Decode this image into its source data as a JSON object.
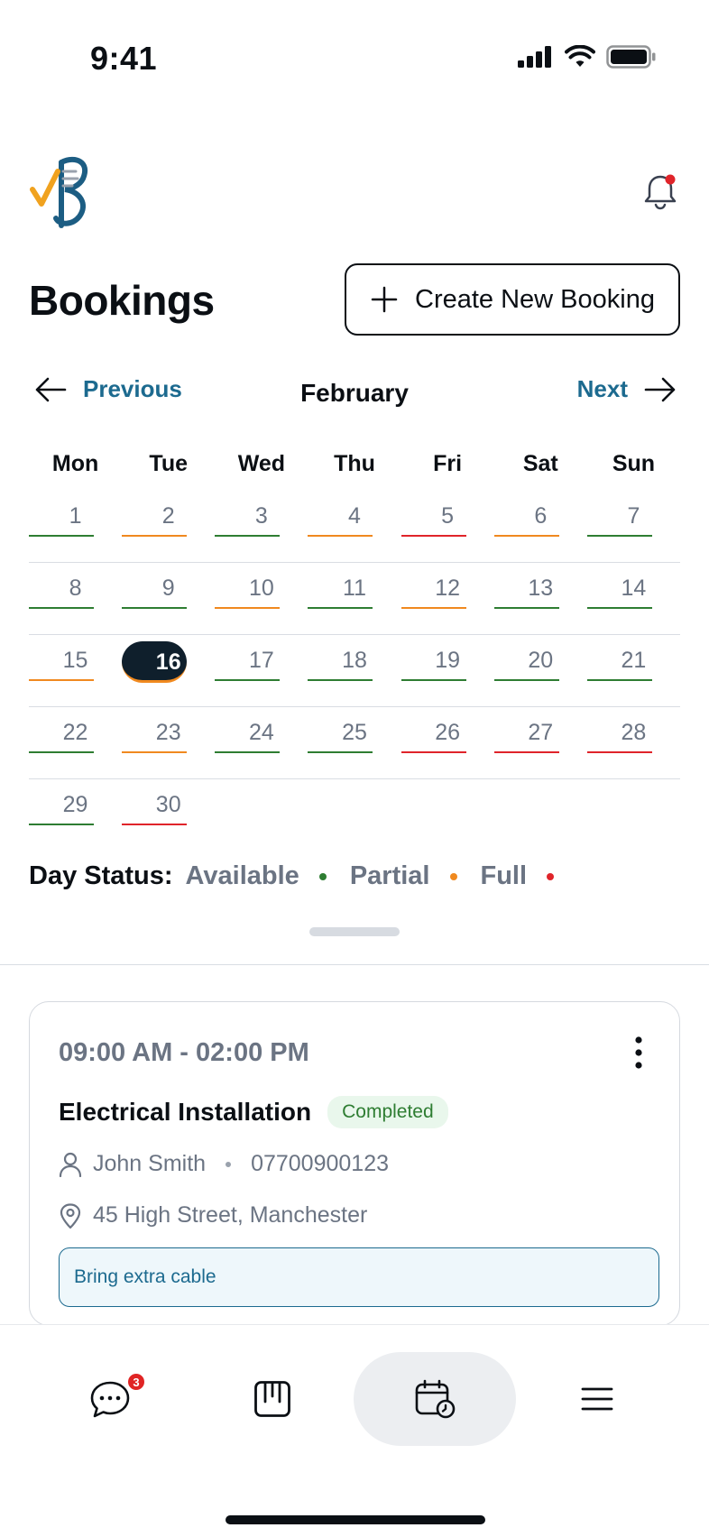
{
  "status_bar": {
    "time": "9:41"
  },
  "header": {
    "page_title": "Bookings",
    "create_button_label": "Create New Booking"
  },
  "month_nav": {
    "prev_label": "Previous",
    "month": "February",
    "next_label": "Next"
  },
  "weekdays": [
    "Mon",
    "Tue",
    "Wed",
    "Thu",
    "Fri",
    "Sat",
    "Sun"
  ],
  "calendar": {
    "selected_day": "16",
    "rows": [
      [
        {
          "d": "1",
          "s": "available"
        },
        {
          "d": "2",
          "s": "partial"
        },
        {
          "d": "3",
          "s": "available"
        },
        {
          "d": "4",
          "s": "partial"
        },
        {
          "d": "5",
          "s": "full"
        },
        {
          "d": "6",
          "s": "partial"
        },
        {
          "d": "7",
          "s": "available"
        }
      ],
      [
        {
          "d": "8",
          "s": "available"
        },
        {
          "d": "9",
          "s": "available"
        },
        {
          "d": "10",
          "s": "partial"
        },
        {
          "d": "11",
          "s": "available"
        },
        {
          "d": "12",
          "s": "partial"
        },
        {
          "d": "13",
          "s": "available"
        },
        {
          "d": "14",
          "s": "available"
        }
      ],
      [
        {
          "d": "15",
          "s": "partial"
        },
        {
          "d": "16",
          "s": "partial"
        },
        {
          "d": "17",
          "s": "available"
        },
        {
          "d": "18",
          "s": "available"
        },
        {
          "d": "19",
          "s": "available"
        },
        {
          "d": "20",
          "s": "available"
        },
        {
          "d": "21",
          "s": "available"
        }
      ],
      [
        {
          "d": "22",
          "s": "available"
        },
        {
          "d": "23",
          "s": "partial"
        },
        {
          "d": "24",
          "s": "available"
        },
        {
          "d": "25",
          "s": "available"
        },
        {
          "d": "26",
          "s": "full"
        },
        {
          "d": "27",
          "s": "full"
        },
        {
          "d": "28",
          "s": "full"
        }
      ],
      [
        {
          "d": "29",
          "s": "available"
        },
        {
          "d": "30",
          "s": "full"
        }
      ]
    ]
  },
  "legend": {
    "title": "Day Status:",
    "items": [
      {
        "label": "Available",
        "key": "available"
      },
      {
        "label": "Partial",
        "key": "partial"
      },
      {
        "label": "Full",
        "key": "full"
      }
    ]
  },
  "colors": {
    "available": "#2e7d32",
    "partial": "#f0891f",
    "full": "#e0242a",
    "accent": "#1c6a8f"
  },
  "booking": {
    "time_range": "09:00 AM - 02:00 PM",
    "title": "Electrical Installation",
    "status": "Completed",
    "customer": "John Smith",
    "phone": "07700900123",
    "address": "45 High Street, Manchester",
    "note": "Bring extra cable"
  },
  "tab_bar": {
    "messages_badge": "3",
    "tabs": [
      {
        "icon": "chat-icon"
      },
      {
        "icon": "board-icon"
      },
      {
        "icon": "calendar-clock-icon",
        "active": true
      },
      {
        "icon": "menu-icon"
      }
    ]
  }
}
